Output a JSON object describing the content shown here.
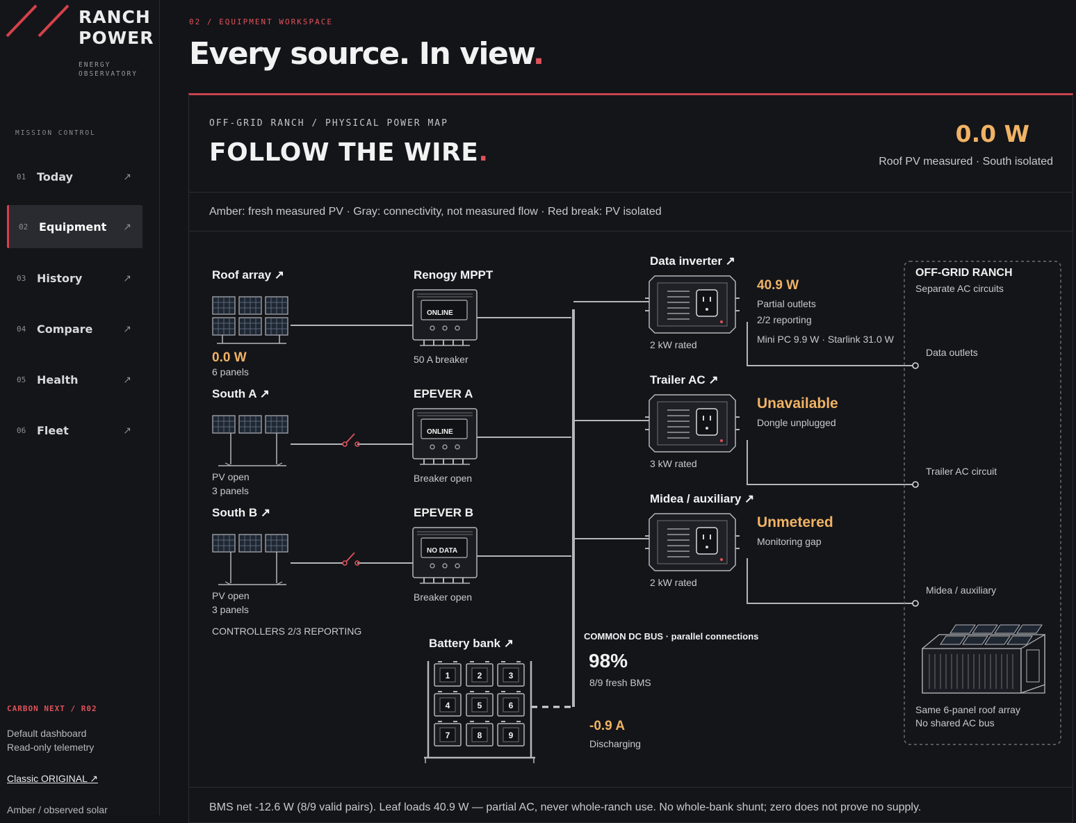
{
  "brand": {
    "name_line1": "RANCH",
    "name_line2": "POWER",
    "sub_line1": "ENERGY",
    "sub_line2": "OBSERVATORY"
  },
  "nav": {
    "title": "MISSION CONTROL",
    "items": [
      {
        "num": "01",
        "label": "Today",
        "active": false
      },
      {
        "num": "02",
        "label": "Equipment",
        "active": true
      },
      {
        "num": "03",
        "label": "History",
        "active": false
      },
      {
        "num": "04",
        "label": "Compare",
        "active": false
      },
      {
        "num": "05",
        "label": "Health",
        "active": false
      },
      {
        "num": "06",
        "label": "Fleet",
        "active": false
      }
    ],
    "arrow": "↗"
  },
  "sidebar_footer": {
    "title": "CARBON NEXT / R02",
    "line1": "Default dashboard",
    "line2": "Read-only telemetry",
    "link": "Classic ORIGINAL ↗",
    "line3": "Amber / observed solar"
  },
  "header": {
    "crumb": "02 / EQUIPMENT WORKSPACE",
    "headline": "Every source. In view",
    "headline_dot": "."
  },
  "map": {
    "eyebrow": "OFF-GRID RANCH / PHYSICAL POWER MAP",
    "title": "FOLLOW THE WIRE",
    "title_dot": ".",
    "kpi_value": "0.0 W",
    "kpi_sub": "Roof PV measured · South isolated",
    "legend": "Amber: fresh measured PV · Gray: connectivity, not measured flow · Red break: PV isolated",
    "footer": "BMS net -12.6 W (8/9 valid pairs). Leaf loads 40.9 W — partial AC, never whole-ranch use. No whole-bank shunt; zero does not prove no supply."
  },
  "sources": [
    {
      "title": "Roof array ↗",
      "value": "0.0 W",
      "line1": "6 panels",
      "line2": "",
      "isolated": false
    },
    {
      "title": "South A ↗",
      "value": "",
      "line1": "PV open",
      "line2": "3 panels",
      "isolated": true
    },
    {
      "title": "South B ↗",
      "value": "",
      "line1": "PV open",
      "line2": "3 panels",
      "isolated": true
    }
  ],
  "controllers_summary": "CONTROLLERS 2/3 REPORTING",
  "controllers": [
    {
      "title": "Renogy MPPT",
      "screen": "ONLINE",
      "caption": "50 A breaker"
    },
    {
      "title": "EPEVER A",
      "screen": "ONLINE",
      "caption": "Breaker open"
    },
    {
      "title": "EPEVER B",
      "screen": "NO DATA",
      "caption": "Breaker open"
    }
  ],
  "inverters": [
    {
      "title": "Data inverter ↗",
      "status": "40.9 W",
      "line1": "Partial outlets",
      "line2": "2/2 reporting",
      "line3": "Mini PC 9.9 W · Starlink 31.0 W",
      "rating": "2 kW rated",
      "circuit": "Data outlets"
    },
    {
      "title": "Trailer AC ↗",
      "status": "Unavailable",
      "line1": "Dongle unplugged",
      "line2": "",
      "line3": "",
      "rating": "3 kW rated",
      "circuit": "Trailer AC circuit"
    },
    {
      "title": "Midea / auxiliary ↗",
      "status": "Unmetered",
      "line1": "Monitoring gap",
      "line2": "",
      "line3": "",
      "rating": "2 kW rated",
      "circuit": "Midea / auxiliary"
    }
  ],
  "ranch": {
    "title": "OFF-GRID RANCH",
    "sub": "Separate AC circuits",
    "note1": "Same 6-panel roof array",
    "note2": "No shared AC bus"
  },
  "bus": {
    "label": "COMMON DC BUS · parallel connections",
    "soc": "98%",
    "soc_sub": "8/9 fresh BMS",
    "current": "-0.9 A",
    "current_sub": "Discharging"
  },
  "battery": {
    "title": "Battery bank ↗",
    "cells": [
      "1",
      "2",
      "3",
      "4",
      "5",
      "6",
      "7",
      "8",
      "9"
    ]
  },
  "colors": {
    "amber": "#f0b365",
    "red": "#e0525b",
    "wire": "#b5b6ba"
  }
}
